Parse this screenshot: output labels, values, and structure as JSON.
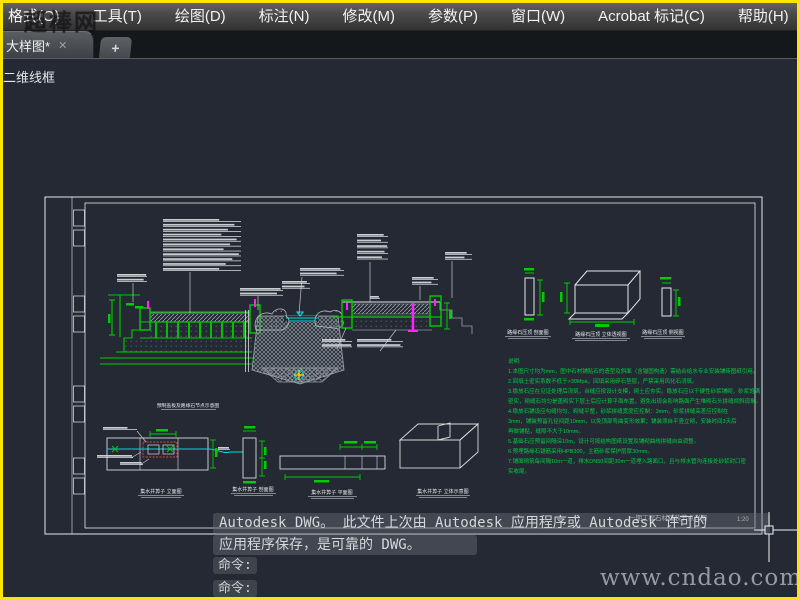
{
  "menu": {
    "items": [
      "格式(O)",
      "工具(T)",
      "绘图(D)",
      "标注(N)",
      "修改(M)",
      "参数(P)",
      "窗口(W)",
      "Acrobat 标记(C)",
      "帮助(H)"
    ]
  },
  "tabs": {
    "active_label": "大样图*",
    "close_glyph": "✕",
    "new_tab_glyph": "+"
  },
  "viewport": {
    "control_label": "二维线框"
  },
  "command_area": {
    "notice_line1": "Autodesk DWG。  此文件上次由 Autodesk 应用程序或 Autodesk 许可的",
    "notice_line2": "应用程序保存，是可靠的 DWG。",
    "prompt1": "命令:",
    "prompt2": "命令:"
  },
  "watermarks": {
    "site": "www.cndao.com",
    "logo": "超棒网"
  },
  "drawing": {
    "sheet_title": "一期工程石材铺装节点详图",
    "sheet_scale": "1:20",
    "labels": {
      "stone_section": "路缘石压顶 剖面图",
      "stone_iso": "路缘石压顶 立体透视图",
      "stone_side": "路缘石压顶 侧视图",
      "well_title": "预制盖板及路缘石节点示意图",
      "well_front": "集水井箅子 立面图",
      "well_section": "集水井箅子 剖面图",
      "well_plan": "集水井箅子 平面图",
      "well_iso": "集水井箅子 立体示意图"
    },
    "notes": {
      "header": "说明:",
      "lines": [
        "1.本图尺寸均为mm，图中石材铺贴石的造型及斜面（含锚固构造）需结合给水专业安装铺砖图纸引用。",
        "2.回填土密实系数不低于>30Mpa，回填采用碎石垫层，严禁采用风化石浇筑。",
        "3.稳放石应在见证处理后浇筑，台缝应按设计支模，砌土应夯实。稳放石应以干硬性砂浆铺砌，砂浆饱满",
        "密实，砌缝石均匀是盖砌实下层土后应计算平面布置，避免出现会影响路面产生堆砌石头拼缝倾斜现象。",
        "4.稳放石铺设应勾缝均匀、砌缝平整，砂浆拼缝宽度应控制：3mm，砂浆拼缝高差应控制在",
        "3mm，铺装预留孔径间距10mm，以免顶部弯曲变形效果；铺装须自平竖立砌，安装时间3天后",
        "再做铺贴，缝隙不大于10mm。",
        "5.基础石应预留间隔深10m，设计可按结构图纸设置及铺砌曲线拼缝自由调整。",
        "6.预埋路缘石锚筋采用HPB300，主筋砂浆保护层厚30mm。",
        "7.铺面砌筑每间隔10m一道，排水DN50间距30m一道埋入路面口，且与排水管沟连接处砂浆封口密",
        "实收尾。"
      ]
    },
    "colors": {
      "cad_green": "#00cc00",
      "magenta": "#ff22ff",
      "cyan": "#00e0e0",
      "frame_white": "#e6e8ea",
      "red_dashed": "#e04545",
      "marker_yellow": "#ffd400"
    }
  }
}
